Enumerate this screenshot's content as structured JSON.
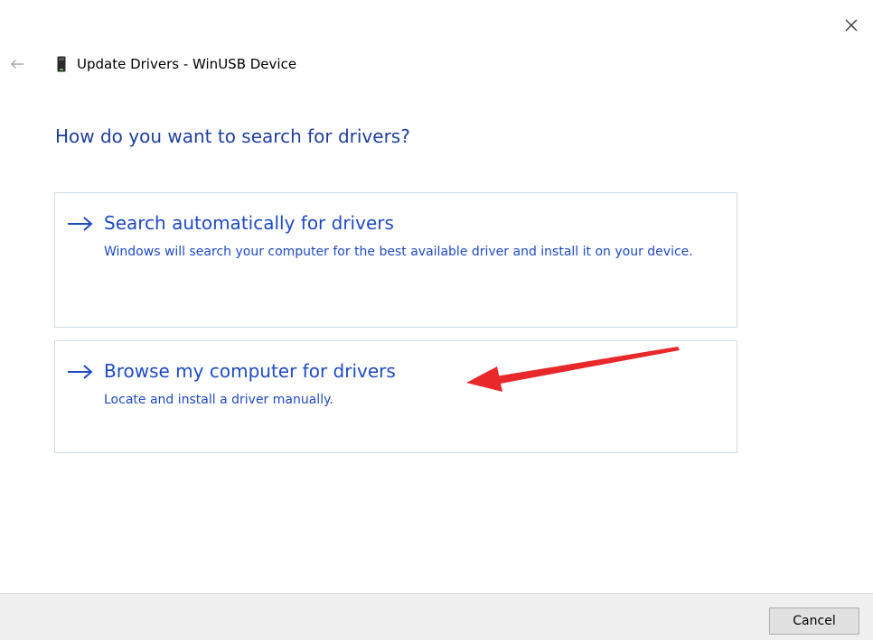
{
  "window": {
    "title": "Update Drivers - WinUSB Device",
    "close_icon": "close-icon",
    "back_icon": "back-arrow-icon",
    "device_icon": "usb-device-icon"
  },
  "heading": "How do you want to search for drivers?",
  "options": [
    {
      "icon": "right-arrow-icon",
      "title": "Search automatically for drivers",
      "description": "Windows will search your computer for the best available driver and install it on your device."
    },
    {
      "icon": "right-arrow-icon",
      "title": "Browse my computer for drivers",
      "description": "Locate and install a driver manually."
    }
  ],
  "annotation": {
    "icon": "red-pointer-arrow",
    "color": "#e8282b"
  },
  "footer": {
    "cancel_label": "Cancel"
  },
  "colors": {
    "heading": "#1e3f9e",
    "link": "#1e4ac4",
    "option_border": "#cfdceb",
    "footer_bg": "#f0f0f0"
  }
}
